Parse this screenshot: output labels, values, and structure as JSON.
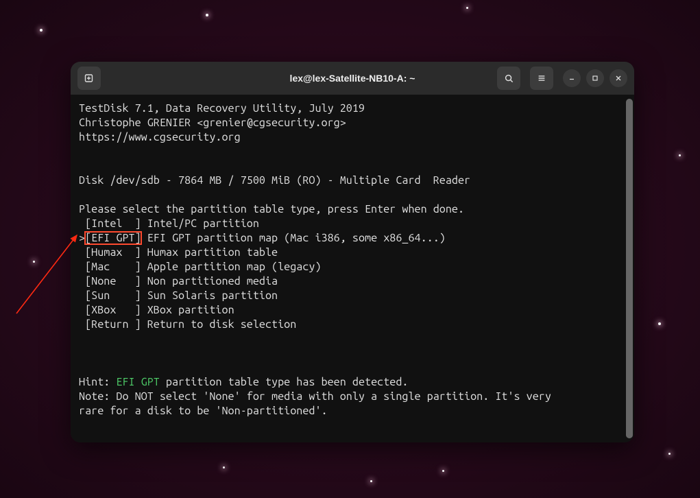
{
  "titlebar": {
    "title": "lex@lex-Satellite-NB10-A: ~"
  },
  "terminal": {
    "header1": "TestDisk 7.1, Data Recovery Utility, July 2019",
    "header2": "Christophe GRENIER <grenier@cgsecurity.org>",
    "header3": "https://www.cgsecurity.org",
    "diskline": "Disk /dev/sdb - 7864 MB / 7500 MiB (RO) - Multiple Card  Reader",
    "prompt": "Please select the partition table type, press Enter when done.",
    "items": {
      "intel": {
        "label": " [Intel  ]",
        "desc": " Intel/PC partition"
      },
      "efi": {
        "marker": ">",
        "label": "[EFI GPT]",
        "desc": " EFI GPT partition map (Mac i386, some x86_64...)"
      },
      "humax": {
        "label": " [Humax  ]",
        "desc": " Humax partition table"
      },
      "mac": {
        "label": " [Mac    ]",
        "desc": " Apple partition map (legacy)"
      },
      "none": {
        "label": " [None   ]",
        "desc": " Non partitioned media"
      },
      "sun": {
        "label": " [Sun    ]",
        "desc": " Sun Solaris partition"
      },
      "xbox": {
        "label": " [XBox   ]",
        "desc": " XBox partition"
      },
      "return": {
        "label": " [Return ]",
        "desc": " Return to disk selection"
      }
    },
    "hint_prefix": "Hint: ",
    "hint_efi": "EFI GPT",
    "hint_suffix": " partition table type has been detected.",
    "note1": "Note: Do NOT select 'None' for media with only a single partition. It's very",
    "note2": "rare for a disk to be 'Non-partitioned'."
  }
}
